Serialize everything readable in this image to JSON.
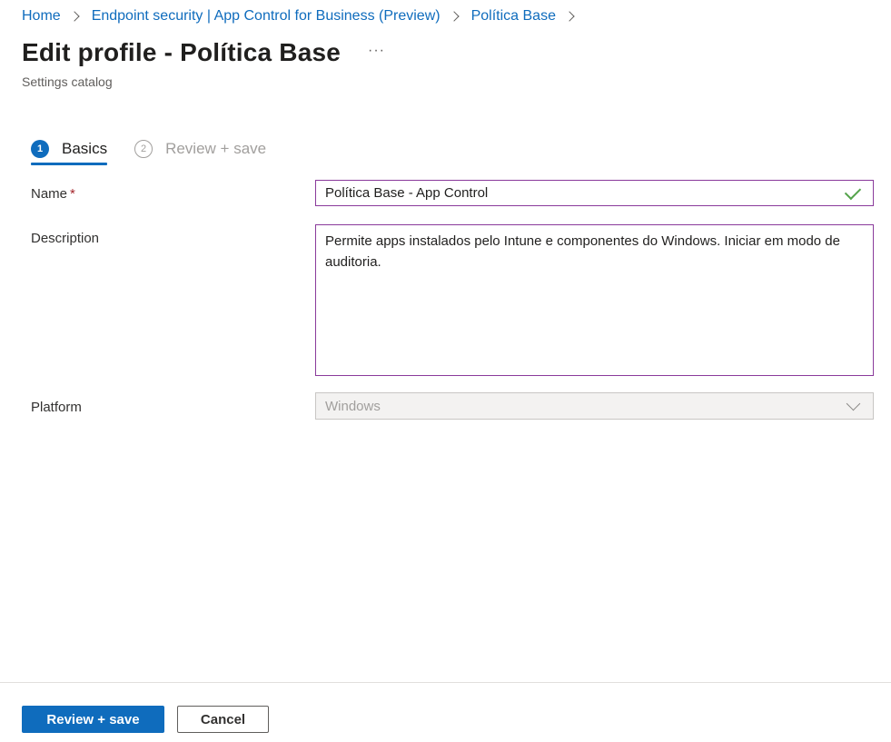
{
  "breadcrumb": {
    "items": [
      "Home",
      "Endpoint security | App Control for Business (Preview)",
      "Política Base"
    ]
  },
  "header": {
    "title": "Edit profile - Política Base",
    "more": "···",
    "subtitle": "Settings catalog"
  },
  "tabs": [
    {
      "number": "1",
      "label": "Basics",
      "active": true
    },
    {
      "number": "2",
      "label": "Review + save",
      "active": false
    }
  ],
  "form": {
    "name": {
      "label": "Name",
      "required_marker": "*",
      "value": "Política Base - App Control",
      "status_icon": "checkmark-icon"
    },
    "description": {
      "label": "Description",
      "value": "Permite apps instalados pelo Intune e componentes do Windows. Iniciar em modo de auditoria."
    },
    "platform": {
      "label": "Platform",
      "value": "Windows",
      "disabled": true,
      "icon": "chevron-down-icon"
    }
  },
  "footer": {
    "primary_label": "Review + save",
    "secondary_label": "Cancel"
  },
  "colors": {
    "accent": "#0f6cbd",
    "focus_border": "#8a3a9b",
    "valid": "#54a34b",
    "required": "#a4262c"
  }
}
